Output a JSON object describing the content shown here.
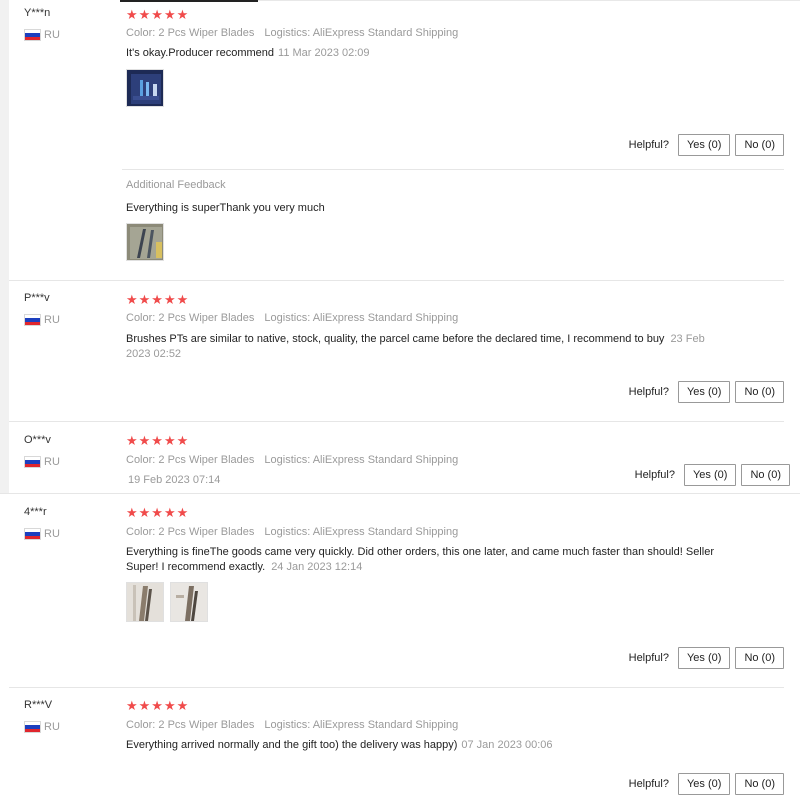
{
  "flag_colors": [
    "#ffffff",
    "#1c3fbf",
    "#e0262d"
  ],
  "star_icon": "star-icon",
  "star_glyphs": "★★★★★",
  "reviews": [
    {
      "name": "Y***n",
      "country": "RU",
      "color": "Color: 2 Pcs Wiper Blades",
      "logistics": "Logistics: AliExpress Standard Shipping",
      "text": "It's okay.Producer recommend",
      "date": "11 Mar 2023 02:09",
      "helpful": "Helpful?",
      "yes": "Yes (0)",
      "no": "No (0)",
      "additional_title": "Additional Feedback",
      "additional_text": "Everything is superThank you very much"
    },
    {
      "name": "P***v",
      "country": "RU",
      "color": "Color: 2 Pcs Wiper Blades",
      "logistics": "Logistics: AliExpress Standard Shipping",
      "text": "Brushes PTs are similar to native, stock, quality, the parcel came before the declared time, I recommend to buy",
      "date_part1": "23 Feb",
      "date_part2": "2023 02:52",
      "helpful": "Helpful?",
      "yes": "Yes (0)",
      "no": "No (0)"
    },
    {
      "name": "O***v",
      "country": "RU",
      "color": "Color: 2 Pcs Wiper Blades",
      "logistics": "Logistics: AliExpress Standard Shipping",
      "date": "19 Feb 2023 07:14",
      "helpful": "Helpful?",
      "yes": "Yes (0)",
      "no": "No (0)"
    },
    {
      "name": "4***r",
      "country": "RU",
      "color": "Color: 2 Pcs Wiper Blades",
      "logistics": "Logistics: AliExpress Standard Shipping",
      "text_line1": "Everything is fineThe goods came very quickly. Did other orders, this one later, and came much faster than should! Seller",
      "text_line2": "Super! I recommend exactly.",
      "date": "24 Jan 2023 12:14",
      "helpful": "Helpful?",
      "yes": "Yes (0)",
      "no": "No (0)"
    },
    {
      "name": "R***V",
      "country": "RU",
      "color": "Color: 2 Pcs Wiper Blades",
      "logistics": "Logistics: AliExpress Standard Shipping",
      "text": "Everything arrived normally and the gift too) the delivery was happy)",
      "date": "07 Jan 2023 00:06",
      "helpful": "Helpful?",
      "yes": "Yes (0)",
      "no": "No (0)"
    }
  ]
}
